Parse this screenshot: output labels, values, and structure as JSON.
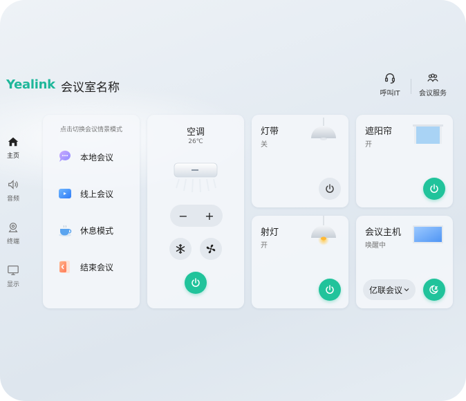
{
  "header": {
    "brand": "Yealink",
    "room_name": "会议室名称",
    "actions": [
      {
        "label": "呼叫IT",
        "icon": "headset-icon"
      },
      {
        "label": "会议服务",
        "icon": "people-icon"
      }
    ]
  },
  "sidebar": {
    "items": [
      {
        "label": "主页",
        "icon": "home-icon",
        "active": true
      },
      {
        "label": "音频",
        "icon": "speaker-icon",
        "active": false
      },
      {
        "label": "终端",
        "icon": "webcam-icon",
        "active": false
      },
      {
        "label": "显示",
        "icon": "monitor-icon",
        "active": false
      }
    ]
  },
  "scenes": {
    "hint": "点击切换会议情景模式",
    "items": [
      {
        "label": "本地会议",
        "icon": "chat-bubble-icon"
      },
      {
        "label": "线上会议",
        "icon": "video-icon"
      },
      {
        "label": "休息模式",
        "icon": "coffee-cup-icon"
      },
      {
        "label": "结束会议",
        "icon": "exit-door-icon"
      }
    ]
  },
  "ac": {
    "title": "空调",
    "temperature": "26℃",
    "minus": "−",
    "plus": "+",
    "power": "on"
  },
  "devices": {
    "light_strip": {
      "title": "灯带",
      "status": "关",
      "power": "off"
    },
    "blinds": {
      "title": "遮阳帘",
      "status": "开",
      "power": "on"
    },
    "spotlight": {
      "title": "射灯",
      "status": "开",
      "power": "on"
    },
    "host": {
      "title": "会议主机",
      "status": "唤醒中",
      "dropdown": "亿联会议"
    }
  },
  "colors": {
    "accent": "#21c39b",
    "brand": "#1fb79a"
  }
}
